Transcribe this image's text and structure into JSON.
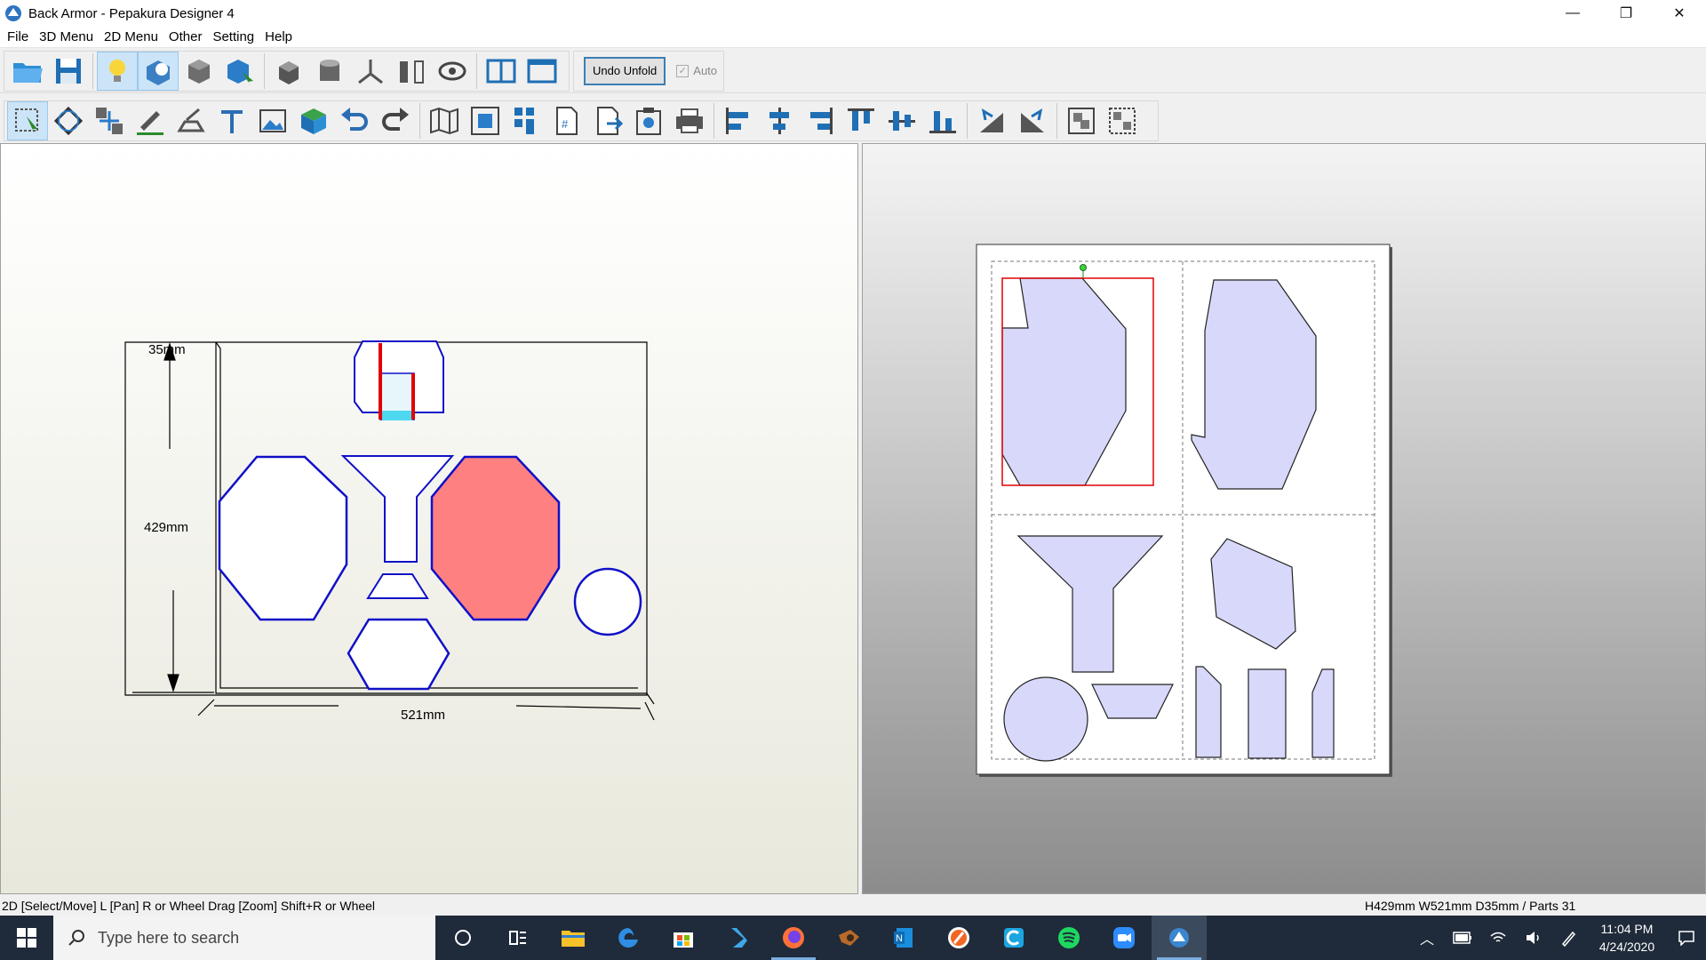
{
  "window": {
    "title": "Back Armor - Pepakura Designer 4",
    "controls": [
      "—",
      "❐",
      "✕"
    ]
  },
  "menu": [
    "File",
    "3D Menu",
    "2D Menu",
    "Other",
    "Setting",
    "Help"
  ],
  "toolbar1": {
    "undo_unfold": "Undo Unfold",
    "auto_label": "Auto",
    "auto_checked": true,
    "icons": [
      "open-folder-icon",
      "save-disk-icon",
      "lightbulb-icon",
      "unfold-view-icon",
      "select-3d-icon",
      "select-3d-arrow-icon",
      "cube-rotate-icon",
      "cylinder-icon",
      "axis-icon",
      "join-edges-icon",
      "eye-rotate-icon",
      "split-view-icon",
      "single-view-icon"
    ]
  },
  "toolbar2": {
    "icons": [
      "select-move-icon",
      "rotate-part-icon",
      "move-parts-icon",
      "pencil-line-icon",
      "edit-flap-icon",
      "text-icon",
      "image-icon",
      "color-cube-icon",
      "undo-icon",
      "redo-icon",
      "map-icon",
      "fit-page-icon",
      "arrange-grid-icon",
      "page-number-icon",
      "export-page-icon",
      "print-preview-icon",
      "print-icon",
      "align-left-icon",
      "align-center-icon",
      "align-right-icon",
      "align-top-icon",
      "align-middle-icon",
      "align-bottom-icon",
      "flip-left-icon",
      "flip-right-icon",
      "group-icon",
      "ungroup-icon"
    ]
  },
  "view3d": {
    "dim_depth": "35mm",
    "dim_height": "429mm",
    "dim_width": "521mm"
  },
  "status": {
    "left": "2D [Select/Move] L [Pan] R or Wheel Drag [Zoom] Shift+R or Wheel",
    "right": "H429mm W521mm D35mm / Parts 31"
  },
  "taskbar": {
    "search_placeholder": "Type here to search",
    "apps": [
      "cortana-icon",
      "task-view-icon",
      "file-explorer-icon",
      "edge-icon",
      "store-icon",
      "vscode-icon",
      "firefox-icon",
      "blender-icon",
      "onenote-icon",
      "app-orange-icon",
      "ccleaner-icon",
      "spotify-icon",
      "zoom-icon",
      "pepakura-icon"
    ],
    "time": "11:04 PM",
    "date": "4/24/2020"
  },
  "colors": {
    "part_fill": "#d8d8fa",
    "selected_outline": "#e00000",
    "selected_fill": "#ff8080",
    "model_edge": "#1010c8"
  }
}
